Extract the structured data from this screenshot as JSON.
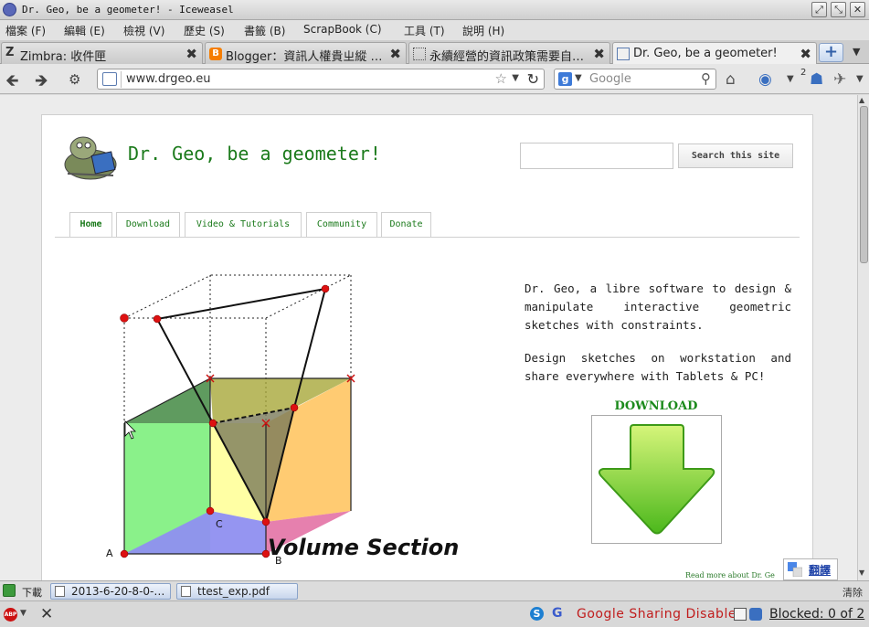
{
  "window": {
    "title": "Dr. Geo, be a geometer! - Iceweasel"
  },
  "menubar": {
    "items": [
      "檔案 (F)",
      "編輯 (E)",
      "檢視 (V)",
      "歷史 (S)",
      "書籤 (B)",
      "ScrapBook (C)",
      "工具 (T)",
      "說明 (H)"
    ]
  },
  "tabs": [
    {
      "label": "Zimbra: 收件匣",
      "icon": "zimbra-icon",
      "active": false
    },
    {
      "label": "Blogger：資訊人權貴ㄓ縱 …",
      "icon": "blogger-icon",
      "active": false
    },
    {
      "label": "永續經營的資訊政策需要自…",
      "icon": "page-icon",
      "active": false
    },
    {
      "label": "Dr. Geo, be a geometer!",
      "icon": "page-icon",
      "active": true
    }
  ],
  "navbar": {
    "url": "www.drgeo.eu",
    "search_placeholder": "Google",
    "badge_count": "2"
  },
  "site": {
    "title": "Dr. Geo, be a geometer!",
    "search_button": "Search this site",
    "nav": [
      "Home",
      "Download",
      "Video & Tutorials",
      "Community",
      "Donate"
    ],
    "intro_1": "Dr. Geo, a libre software to design & manipulate interactive geometric sketches with constraints.",
    "intro_2": "Design sketches on workstation and share everywhere with Tablets & PC!",
    "download_heading": "DOWNLOAD",
    "read_more": "Read more about Dr. Ge",
    "figure": {
      "caption": "Volume Section",
      "point_labels": [
        "A",
        "B",
        "C"
      ]
    }
  },
  "translate": {
    "label": "翻譯"
  },
  "downloads": {
    "label": "下載",
    "items": [
      "2013-6-20-8-0-…",
      "ttest_exp.pdf"
    ],
    "clear": "清除"
  },
  "statusbar": {
    "abp": "ABP",
    "sharing": "Google Sharing Disabled",
    "blocked": "Blocked: 0 of 2"
  },
  "colors": {
    "site_green": "#1b7a1b",
    "sharing_red": "#c01d1d",
    "link_blue": "#1a3fa6"
  }
}
